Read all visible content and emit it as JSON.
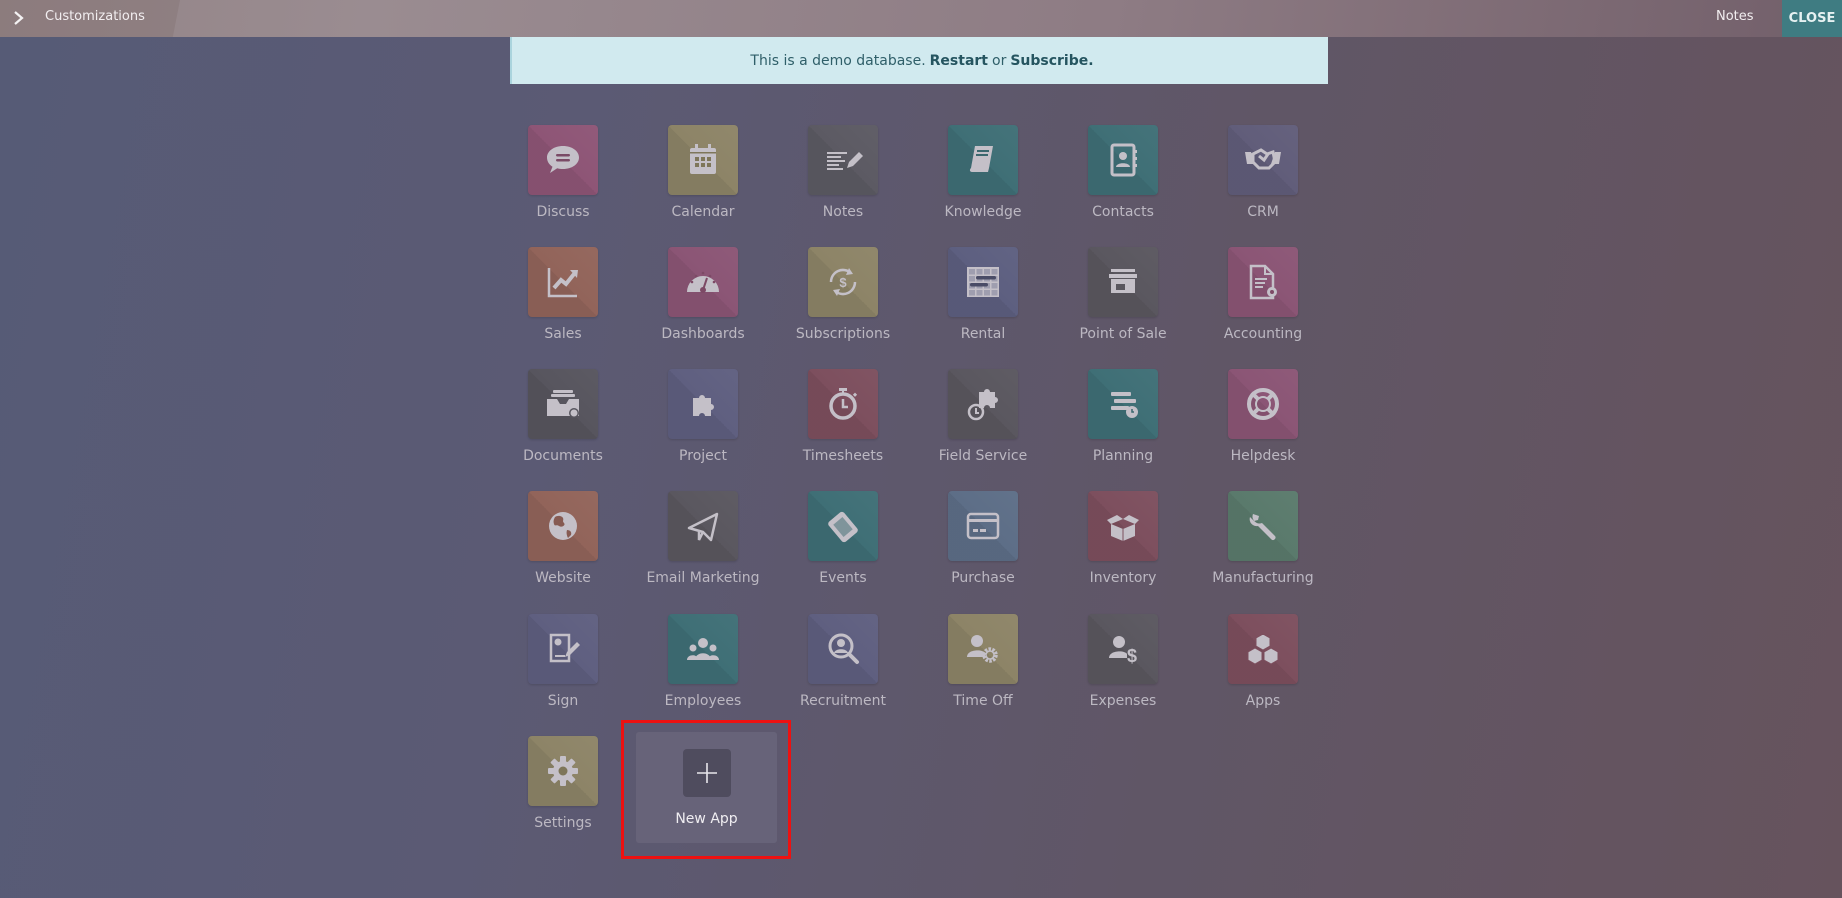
{
  "topbar": {
    "breadcrumb": "Customizations",
    "notes_label": "Notes",
    "close_label": "CLOSE"
  },
  "banner": {
    "text": "This is a demo database.",
    "restart_label": "Restart",
    "or_text": "or",
    "subscribe_label": "Subscribe."
  },
  "apps": [
    {
      "label": "Discuss",
      "icon": "chat-bubble-icon",
      "color": "#8e5576"
    },
    {
      "label": "Calendar",
      "icon": "calendar-icon",
      "color": "#8d8467"
    },
    {
      "label": "Notes",
      "icon": "notes-pencil-icon",
      "color": "#5c5a63"
    },
    {
      "label": "Knowledge",
      "icon": "book-icon",
      "color": "#3f6f76"
    },
    {
      "label": "Contacts",
      "icon": "address-book-icon",
      "color": "#3f6f76"
    },
    {
      "label": "CRM",
      "icon": "handshake-icon",
      "color": "#615d7a"
    },
    {
      "label": "Sales",
      "icon": "chart-trend-icon",
      "color": "#92645a"
    },
    {
      "label": "Dashboards",
      "icon": "gauge-icon",
      "color": "#8b5575"
    },
    {
      "label": "Subscriptions",
      "icon": "recurring-dollar-icon",
      "color": "#8d8467"
    },
    {
      "label": "Rental",
      "icon": "gantt-grid-icon",
      "color": "#5d5f80"
    },
    {
      "label": "Point of Sale",
      "icon": "store-icon",
      "color": "#5a575f"
    },
    {
      "label": "Accounting",
      "icon": "document-gear-icon",
      "color": "#8b5575"
    },
    {
      "label": "Documents",
      "icon": "inbox-check-icon",
      "color": "#57555e"
    },
    {
      "label": "Project",
      "icon": "puzzle-icon",
      "color": "#5f5f80"
    },
    {
      "label": "Timesheets",
      "icon": "stopwatch-icon",
      "color": "#7d4f5e"
    },
    {
      "label": "Field Service",
      "icon": "puzzle-stopwatch-icon",
      "color": "#5a575f"
    },
    {
      "label": "Planning",
      "icon": "planning-clock-icon",
      "color": "#3f6f76"
    },
    {
      "label": "Helpdesk",
      "icon": "lifebuoy-icon",
      "color": "#8b5575"
    },
    {
      "label": "Website",
      "icon": "globe-icon",
      "color": "#92645a"
    },
    {
      "label": "Email Marketing",
      "icon": "paper-plane-icon",
      "color": "#5a575f"
    },
    {
      "label": "Events",
      "icon": "ticket-icon",
      "color": "#3f6f76"
    },
    {
      "label": "Purchase",
      "icon": "credit-card-icon",
      "color": "#5d6e87"
    },
    {
      "label": "Inventory",
      "icon": "open-box-icon",
      "color": "#7d4f5e"
    },
    {
      "label": "Manufacturing",
      "icon": "wrench-icon",
      "color": "#5a7a6c"
    },
    {
      "label": "Sign",
      "icon": "signature-icon",
      "color": "#5f5f80"
    },
    {
      "label": "Employees",
      "icon": "people-group-icon",
      "color": "#3f6f76"
    },
    {
      "label": "Recruitment",
      "icon": "person-search-icon",
      "color": "#5f5f80"
    },
    {
      "label": "Time Off",
      "icon": "person-gear-icon",
      "color": "#8d8467"
    },
    {
      "label": "Expenses",
      "icon": "person-dollar-icon",
      "color": "#5a575f"
    },
    {
      "label": "Apps",
      "icon": "cubes-icon",
      "color": "#7d4f5e"
    },
    {
      "label": "Settings",
      "icon": "gear-icon",
      "color": "#8d8467"
    }
  ],
  "new_app": {
    "label": "New App",
    "icon": "plus-icon",
    "highlight_color": "#ee1111"
  },
  "colors": {
    "close_button": "#3f7c82",
    "banner_bg": "#d1eaef",
    "icon_glyph": "#c4c0c8"
  }
}
